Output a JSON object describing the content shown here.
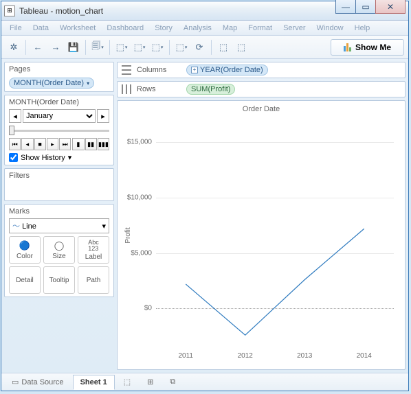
{
  "window": {
    "title": "Tableau - motion_chart"
  },
  "menu": [
    "File",
    "Data",
    "Worksheet",
    "Dashboard",
    "Story",
    "Analysis",
    "Map",
    "Format",
    "Server",
    "Window",
    "Help"
  ],
  "toolbar": {
    "showme": "Show Me"
  },
  "pages": {
    "title": "Pages",
    "pill": "MONTH(Order Date)",
    "selector_label": "MONTH(Order Date)",
    "current": "January",
    "history": "Show History"
  },
  "filters": {
    "title": "Filters"
  },
  "marks": {
    "title": "Marks",
    "type": "Line",
    "buttons": [
      "Color",
      "Size",
      "Label",
      "Detail",
      "Tooltip",
      "Path"
    ]
  },
  "shelves": {
    "columns_label": "Columns",
    "columns_pill": "YEAR(Order Date)",
    "rows_label": "Rows",
    "rows_pill": "SUM(Profit)"
  },
  "bottom": {
    "datasource": "Data Source",
    "sheet": "Sheet 1"
  },
  "chart_data": {
    "type": "line",
    "title": "Order Date",
    "ylabel": "Profit",
    "x": [
      2011,
      2012,
      2013,
      2014
    ],
    "values": [
      2200,
      -2400,
      2600,
      7200
    ],
    "yticks": [
      0,
      5000,
      10000,
      15000
    ],
    "ytick_labels": [
      "$0",
      "$5,000",
      "$10,000",
      "$15,000"
    ],
    "ylim": [
      -3500,
      17000
    ]
  }
}
